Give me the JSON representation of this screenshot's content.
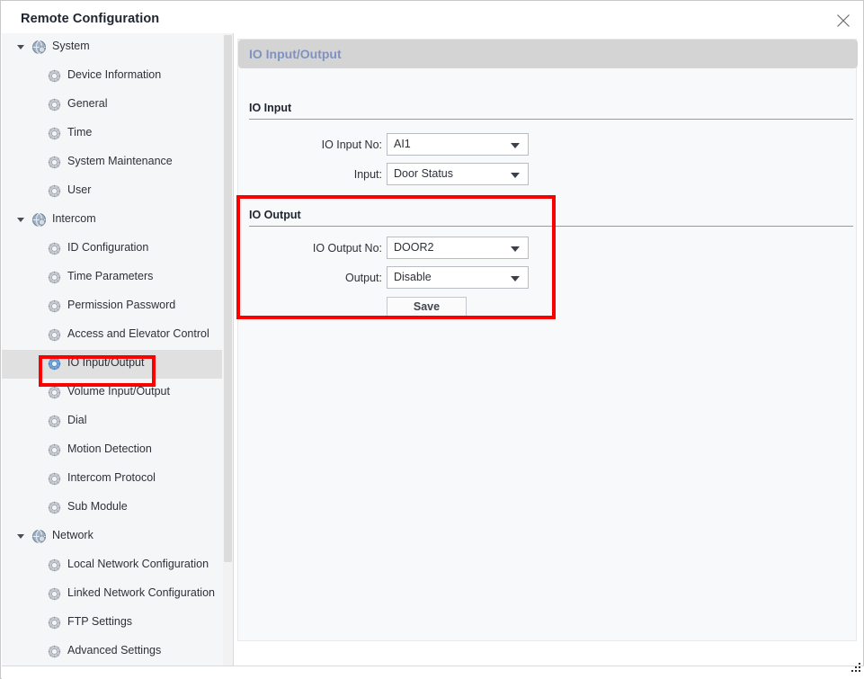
{
  "window": {
    "title": "Remote Configuration",
    "close_icon": "close-icon"
  },
  "sidebar": {
    "scrollbar": "vertical-scrollbar",
    "groups": [
      {
        "label": "System",
        "icon": "globe-icon",
        "expanded": true,
        "items": [
          {
            "label": "Device Information",
            "icon": "gear-icon"
          },
          {
            "label": "General",
            "icon": "gear-icon"
          },
          {
            "label": "Time",
            "icon": "gear-icon"
          },
          {
            "label": "System Maintenance",
            "icon": "gear-icon"
          },
          {
            "label": "User",
            "icon": "gear-icon"
          }
        ]
      },
      {
        "label": "Intercom",
        "icon": "globe-icon",
        "expanded": true,
        "items": [
          {
            "label": "ID Configuration",
            "icon": "gear-icon"
          },
          {
            "label": "Time Parameters",
            "icon": "gear-icon"
          },
          {
            "label": "Permission Password",
            "icon": "gear-icon"
          },
          {
            "label": "Access and Elevator Control",
            "icon": "gear-icon"
          },
          {
            "label": "IO Input/Output",
            "icon": "gear-icon",
            "selected": true
          },
          {
            "label": "Volume Input/Output",
            "icon": "gear-icon"
          },
          {
            "label": "Dial",
            "icon": "gear-icon"
          },
          {
            "label": "Motion Detection",
            "icon": "gear-icon"
          },
          {
            "label": "Intercom Protocol",
            "icon": "gear-icon"
          },
          {
            "label": "Sub Module",
            "icon": "gear-icon"
          }
        ]
      },
      {
        "label": "Network",
        "icon": "globe-icon",
        "expanded": true,
        "items": [
          {
            "label": "Local Network Configuration",
            "icon": "gear-icon"
          },
          {
            "label": "Linked Network Configuration",
            "icon": "gear-icon"
          },
          {
            "label": "FTP Settings",
            "icon": "gear-icon"
          },
          {
            "label": "Advanced Settings",
            "icon": "gear-icon"
          }
        ]
      }
    ]
  },
  "panel": {
    "header": "IO Input/Output",
    "io_input": {
      "title": "IO Input",
      "fields": [
        {
          "label": "IO Input No:",
          "value": "AI1"
        },
        {
          "label": "Input:",
          "value": "Door Status"
        }
      ]
    },
    "io_output": {
      "title": "IO Output",
      "fields": [
        {
          "label": "IO Output No:",
          "value": "DOOR2"
        },
        {
          "label": "Output:",
          "value": "Disable"
        }
      ],
      "save_label": "Save"
    }
  },
  "annotations": {
    "color": "#FC0000",
    "boxes": [
      {
        "target": "sidebar-item-io-input-output"
      },
      {
        "target": "io-output-section"
      }
    ]
  }
}
